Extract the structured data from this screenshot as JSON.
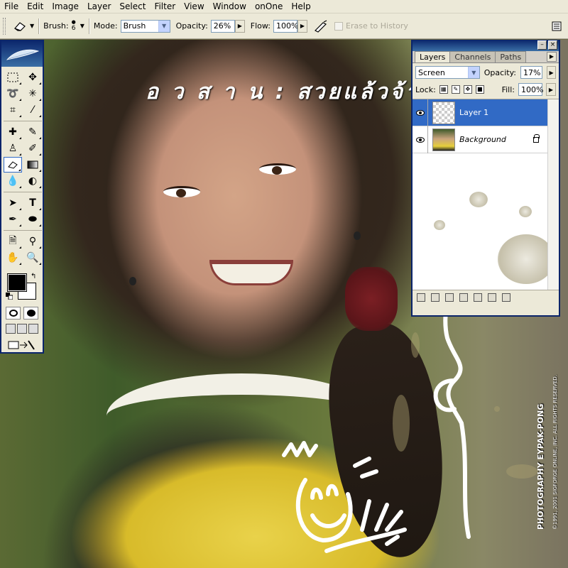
{
  "menubar": {
    "items": [
      "File",
      "Edit",
      "Image",
      "Layer",
      "Select",
      "Filter",
      "View",
      "Window",
      "onOne",
      "Help"
    ]
  },
  "options": {
    "brush_label": "Brush:",
    "brush_size": "6",
    "mode_label": "Mode:",
    "mode_value": "Brush",
    "opacity_label": "Opacity:",
    "opacity_value": "26%",
    "flow_label": "Flow:",
    "flow_value": "100%",
    "erase_history_label": "Erase to History"
  },
  "canvas": {
    "thai_text": "อ ว ส า น : สวยแล้วจ้า.....",
    "credit_text": "PHOTOGRAPHY EYPAK-PONG",
    "copyright_text": "©1991, 2001 SIGFORGE ONLINE, INC. ALL RIGHTS RESERVED."
  },
  "layers_panel": {
    "tabs": [
      "Layers",
      "Channels",
      "Paths"
    ],
    "blend_mode": "Screen",
    "opacity_label": "Opacity:",
    "opacity_value": "17%",
    "lock_label": "Lock:",
    "fill_label": "Fill:",
    "fill_value": "100%",
    "layers": [
      {
        "name": "Layer 1",
        "selected": true
      },
      {
        "name": "Background",
        "selected": false
      }
    ]
  },
  "icons": {
    "eraser": "eraser-icon",
    "palette_well": "palette-well-icon"
  },
  "colors": {
    "foreground": "#000000",
    "background": "#ffffff",
    "selection": "#316ac5",
    "title_bar": "#0a246a"
  }
}
